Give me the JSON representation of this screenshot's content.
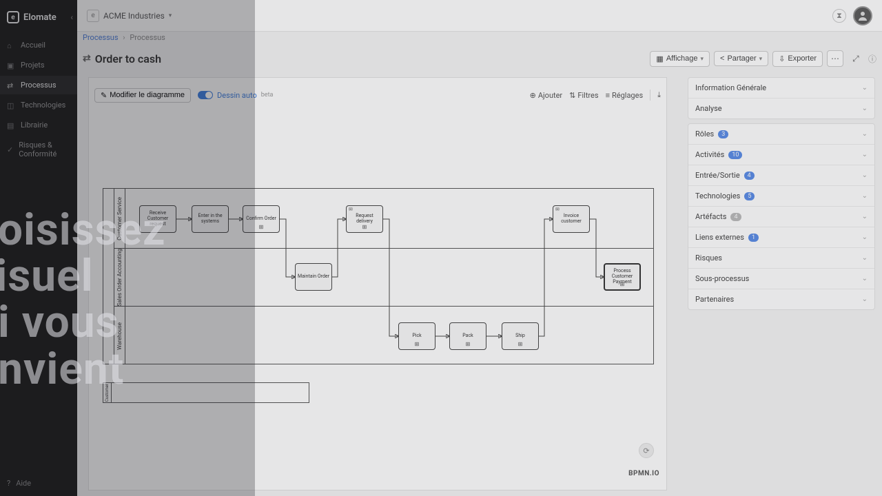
{
  "brand": "Elomate",
  "org": "ACME Industries",
  "sidebar": {
    "items": [
      {
        "label": "Accueil"
      },
      {
        "label": "Projets"
      },
      {
        "label": "Processus"
      },
      {
        "label": "Technologies"
      },
      {
        "label": "Librairie"
      },
      {
        "label": "Risques & Conformité"
      }
    ],
    "bottom": "Aide"
  },
  "breadcrumb": {
    "root": "Processus",
    "current": "Processus"
  },
  "title": "Order to cash",
  "toolbar": {
    "display": "Affichage",
    "share": "Partager",
    "export": "Exporter"
  },
  "canvas": {
    "edit": "Modifier le diagramme",
    "toggle": "Dessin auto",
    "beta": "beta",
    "add": "Ajouter",
    "filters": "Filtres",
    "settings": "Réglages"
  },
  "pool": {
    "name": "",
    "lanes": [
      {
        "name": "Customer Service"
      },
      {
        "name": "Sales Order Accounting"
      },
      {
        "name": "Warehouse"
      }
    ]
  },
  "tasks": {
    "receive": "Receive Customer request",
    "enter": "Enter in the systems",
    "confirm": "Confirm Order",
    "request": "Request delivery",
    "invoice": "Invoice customer",
    "maintain": "Maintain Order",
    "process": "Process Customer Payment",
    "pick": "Pick",
    "pack": "Pack",
    "ship": "Ship"
  },
  "pool2": "Customer",
  "props": {
    "g1": [
      {
        "label": "Information Générale"
      },
      {
        "label": "Analyse"
      }
    ],
    "g2": [
      {
        "label": "Rôles",
        "count": "3"
      },
      {
        "label": "Activités",
        "count": "10"
      },
      {
        "label": "Entrée/Sortie",
        "count": "4"
      },
      {
        "label": "Technologies",
        "count": "5"
      },
      {
        "label": "Artéfacts",
        "count": "4",
        "gray": true
      },
      {
        "label": "Liens externes",
        "count": "1"
      },
      {
        "label": "Risques"
      },
      {
        "label": "Sous-processus"
      },
      {
        "label": "Partenaires"
      }
    ]
  },
  "bpmn": "BPMN.IO",
  "ghost": [
    "hoisissez",
    " visuel",
    "ui vous",
    "onvient"
  ]
}
